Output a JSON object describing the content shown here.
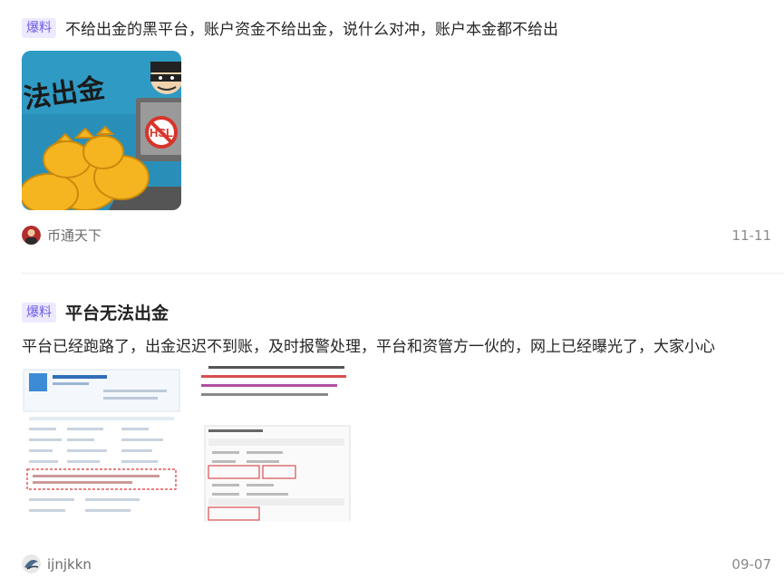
{
  "posts": [
    {
      "tag": "爆料",
      "title": "不给出金的黑平台，账户资金不给出金，说什么对冲，账户本金都不给出",
      "thumbnail": {
        "overlay_text": "法出金",
        "sign_text": "HSL"
      },
      "author": "币通天下",
      "date": "11-11"
    },
    {
      "tag": "爆料",
      "title": "平台无法出金",
      "summary": "平台已经跑路了，出金迟迟不到账，及时报警处理，平台和资管方一伙的，网上已经曝光了，大家小心",
      "author": "ijnjkkn",
      "date": "09-07"
    }
  ],
  "colors": {
    "tag_bg": "#edeaff",
    "tag_text": "#6c5ce7",
    "thumb_bg": "#2a8fb8"
  }
}
